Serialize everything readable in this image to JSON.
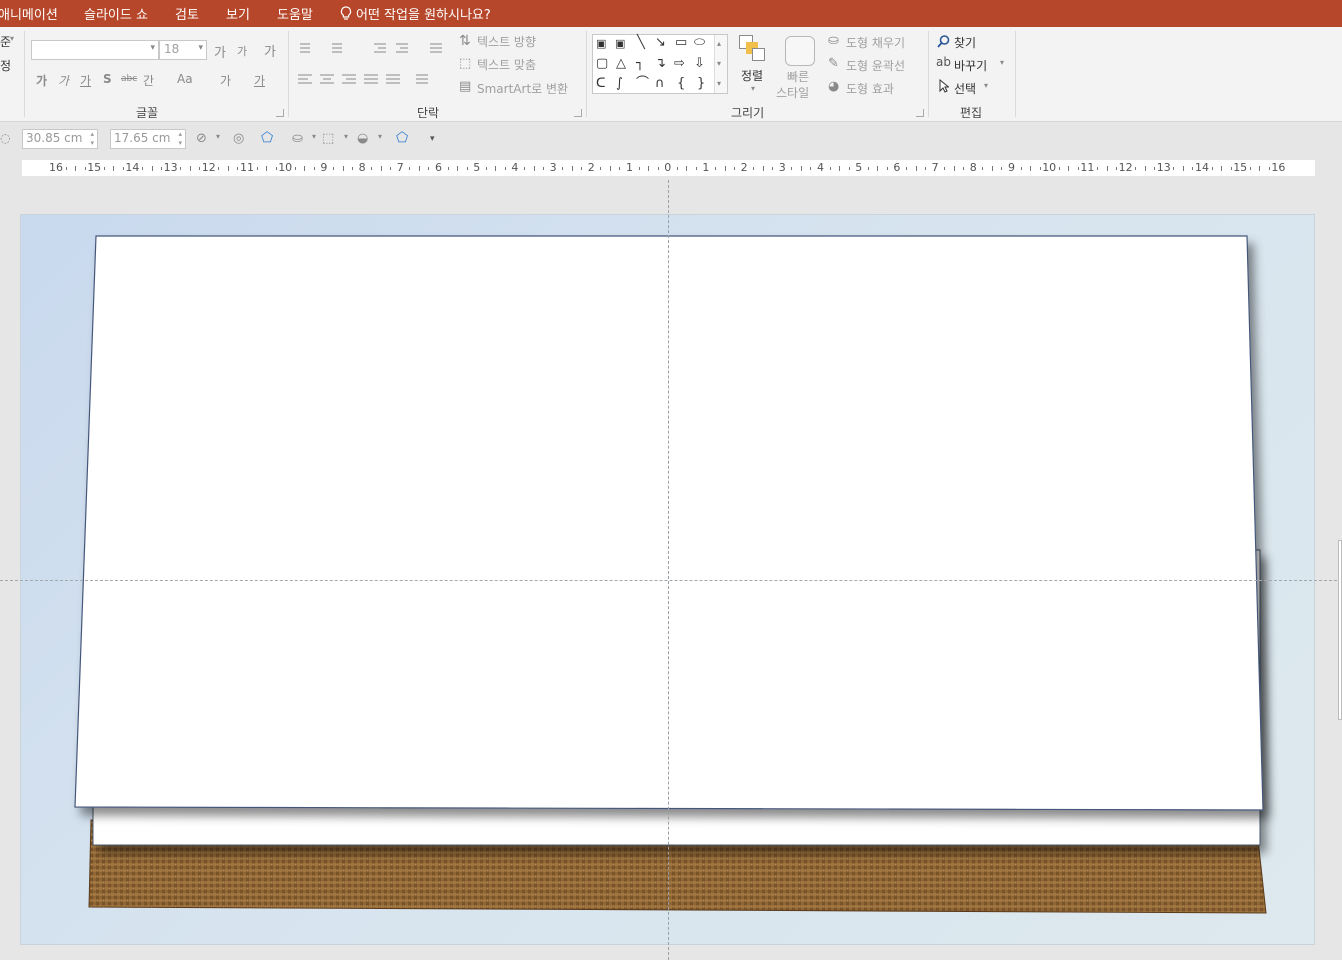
{
  "menu": {
    "items": [
      "애니메이션",
      "슬라이드 쇼",
      "검토",
      "보기",
      "도움말"
    ],
    "tell_me": "어떤 작업을 원하시나요?"
  },
  "ribbon": {
    "font": {
      "name_value": "",
      "size_value": "18",
      "label": "글꼴",
      "row1": [
        "가",
        "가",
        "가"
      ],
      "row2": [
        "가",
        "가",
        "가",
        "S",
        "abc",
        "간",
        "Aa",
        "가",
        "가"
      ]
    },
    "left_partial": [
      "준",
      "정"
    ],
    "paragraph": {
      "text_direction": "텍스트 방향",
      "align_text": "텍스트 맞춤",
      "smartart": "SmartArt로 변환",
      "label": "단락"
    },
    "drawing": {
      "arrange": "정렬",
      "quick_styles_1": "빠른",
      "quick_styles_2": "스타일",
      "shape_fill": "도형 채우기",
      "shape_outline": "도형 윤곽선",
      "shape_effects": "도형 효과",
      "label": "그리기"
    },
    "editing": {
      "find": "찾기",
      "replace": "바꾸기",
      "select": "선택",
      "label": "편집"
    }
  },
  "toolbar2": {
    "width": "30.85 cm",
    "height": "17.65 cm"
  },
  "ruler": {
    "labels": [
      "16",
      "15",
      "14",
      "13",
      "12",
      "11",
      "10",
      "9",
      "8",
      "7",
      "6",
      "5",
      "4",
      "3",
      "2",
      "1",
      "0",
      "1",
      "2",
      "3",
      "4",
      "5",
      "6",
      "7",
      "8",
      "9",
      "10",
      "11",
      "12",
      "13",
      "14",
      "15",
      "16"
    ]
  },
  "icons": {
    "tell_me": "lightbulb-icon",
    "find": "magnifier-icon",
    "select": "cursor-icon"
  },
  "colors": {
    "accent": "#b7472a",
    "slide_bg": "#d4e2ef",
    "cardboard": "#8a6134"
  }
}
